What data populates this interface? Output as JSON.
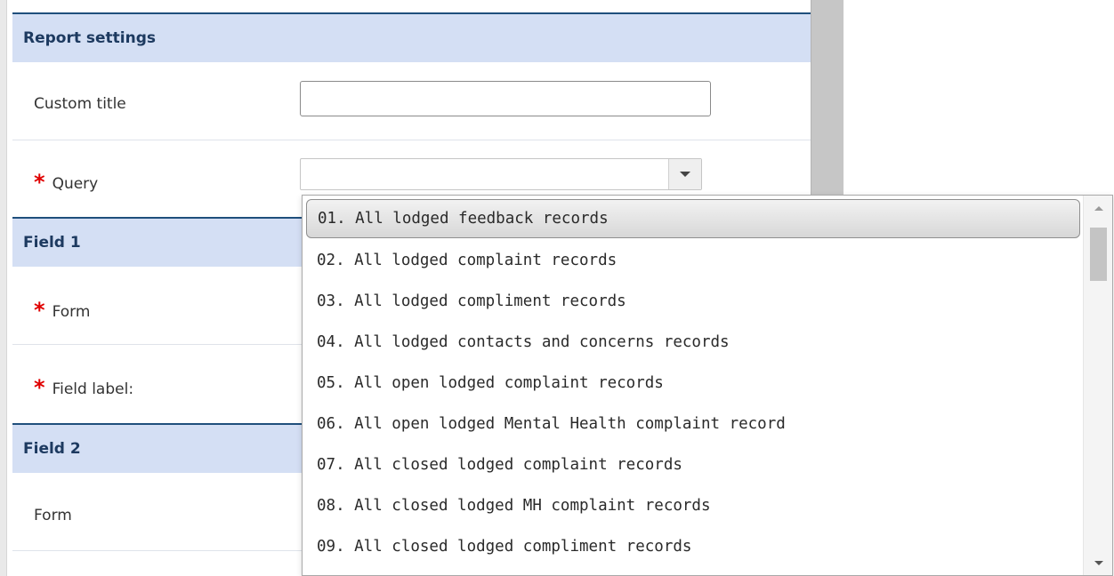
{
  "report_settings": {
    "header": "Report settings",
    "custom_title": {
      "label": "Custom title",
      "value": "",
      "placeholder": ""
    },
    "query": {
      "label": "Query",
      "required_marker": "*",
      "value": ""
    }
  },
  "field1": {
    "header": "Field 1",
    "form": {
      "label": "Form",
      "required_marker": "*"
    },
    "field_label": {
      "label": "Field label:",
      "required_marker": "*"
    }
  },
  "field2": {
    "header": "Field 2",
    "form": {
      "label": "Form"
    }
  },
  "query_dropdown": {
    "options": [
      "01. All lodged feedback records",
      "02. All lodged complaint records",
      "03. All lodged compliment records",
      "04. All lodged contacts and concerns records",
      "05. All open lodged complaint records",
      "06. All open lodged Mental Health complaint record",
      "07. All closed lodged complaint records",
      "08. All closed lodged MH complaint records",
      "09. All closed lodged compliment records"
    ],
    "highlighted_index": 0
  },
  "icons": {
    "combo_arrow": "chevron-down-icon",
    "scroll_up": "scroll-up-icon",
    "scroll_down": "scroll-down-icon"
  },
  "colors": {
    "section_header_bg": "#d4dff4",
    "section_header_border": "#1f4f7c",
    "required_star": "#e00000"
  }
}
